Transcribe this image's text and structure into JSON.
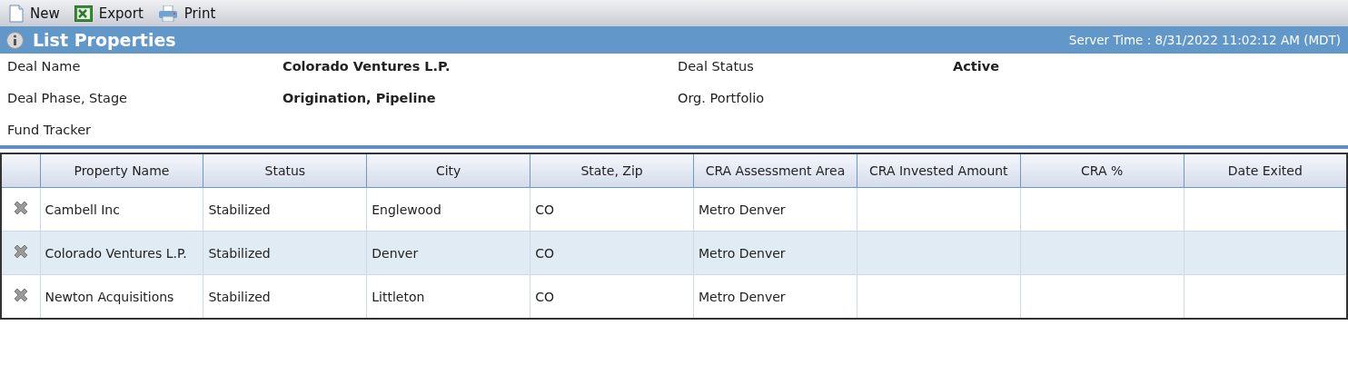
{
  "toolbar": [
    {
      "kind": "new",
      "label": "New"
    },
    {
      "kind": "export",
      "label": "Export"
    },
    {
      "kind": "print",
      "label": "Print"
    }
  ],
  "header": {
    "title": "List Properties",
    "server_time": "Server Time : 8/31/2022 11:02:12 AM (MDT)"
  },
  "deal_info": [
    {
      "label": "Deal Name",
      "value": "Colorado Ventures L.P."
    },
    {
      "label": "Deal Status",
      "value": "Active"
    },
    {
      "label": "Deal Phase, Stage",
      "value": "Origination, Pipeline"
    },
    {
      "label": "Org. Portfolio"
    },
    {
      "label": "Fund Tracker"
    }
  ],
  "table": {
    "columns": [
      "Property Name",
      "Status",
      "City",
      "State, Zip",
      "CRA Assessment Area",
      "CRA Invested Amount",
      "CRA %",
      "Date Exited"
    ],
    "rows": [
      {
        "cells": [
          "Cambell Inc",
          "Stabilized",
          "Englewood",
          "CO",
          "Metro Denver"
        ]
      },
      {
        "cells": [
          "Colorado Ventures L.P.",
          "Stabilized",
          "Denver",
          "CO",
          "Metro Denver"
        ]
      },
      {
        "cells": [
          "Newton Acquisitions",
          "Stabilized",
          "Littleton",
          "CO",
          "Metro Denver"
        ]
      }
    ]
  }
}
